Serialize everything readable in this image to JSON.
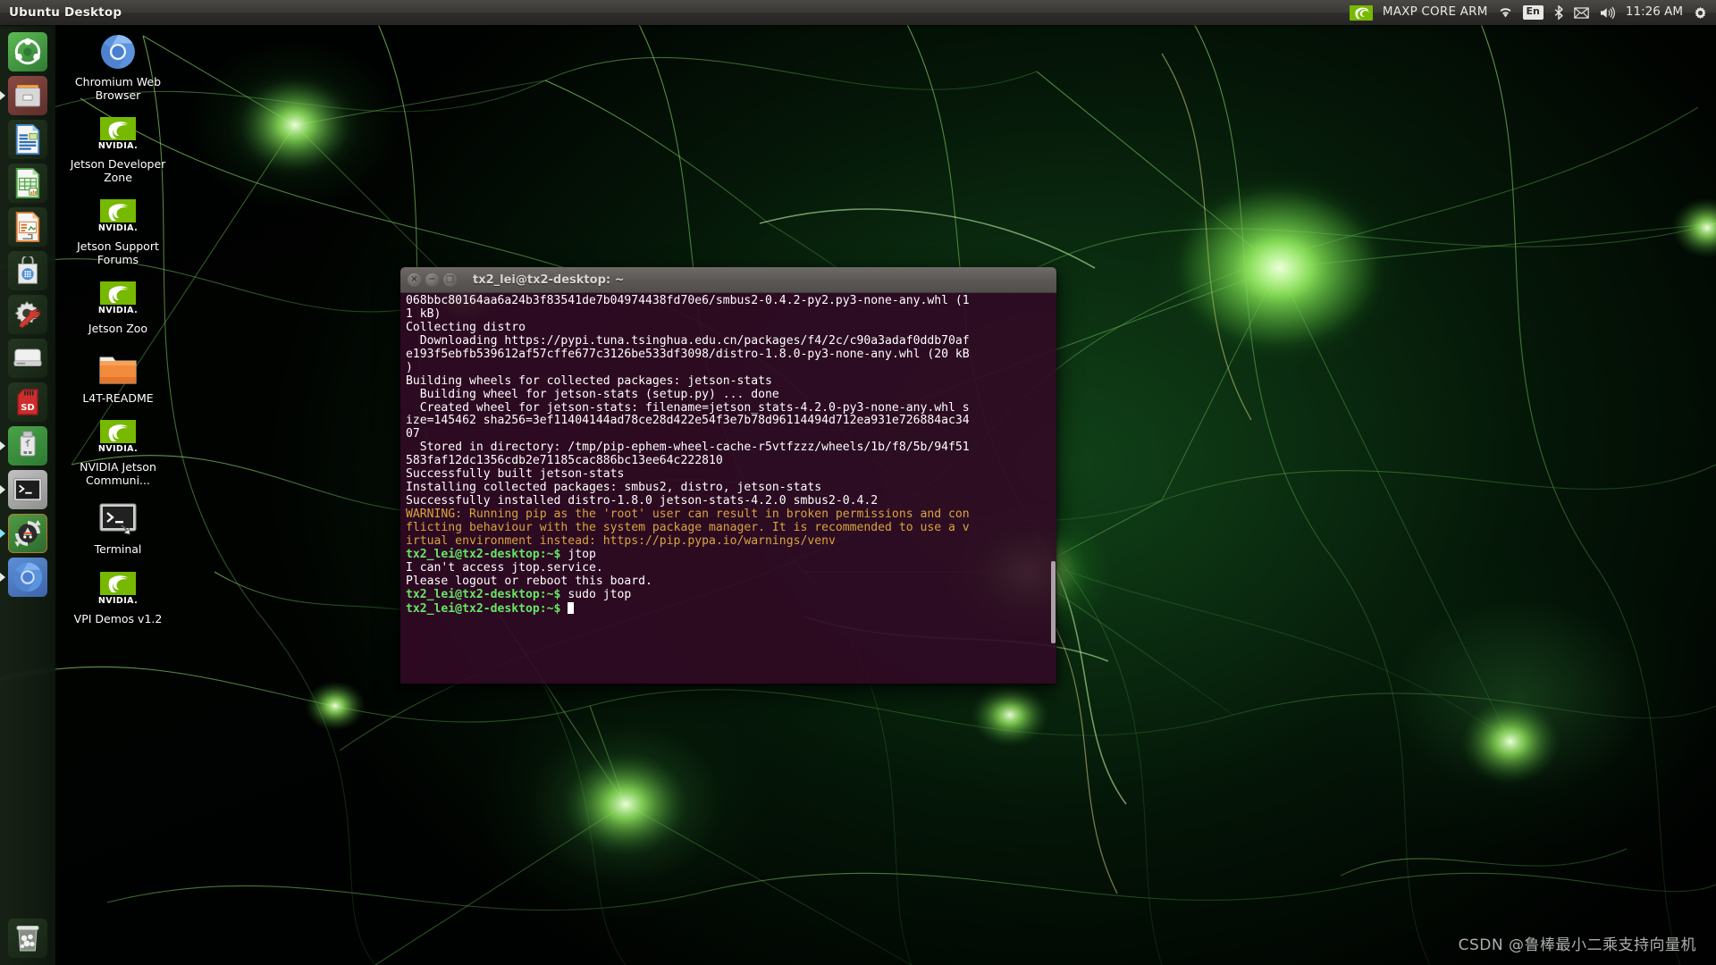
{
  "panel": {
    "title": "Ubuntu Desktop",
    "tray": {
      "nvidia_icon": "nvidia-eye-icon",
      "label": "MAXP CORE ARM",
      "wifi_icon": "wifi-icon",
      "language": "En",
      "bluetooth_icon": "bluetooth-icon",
      "mail_icon": "mail-icon",
      "volume_icon": "volume-icon",
      "clock": "11:26 AM",
      "gear_icon": "gear-icon"
    }
  },
  "launcher": {
    "items": [
      {
        "name": "dash-home",
        "icon": "ubuntu-logo-icon",
        "running": false,
        "accent": "#3f9142"
      },
      {
        "name": "files",
        "icon": "file-manager-icon",
        "running": true,
        "accent": "#7c3a36"
      },
      {
        "name": "libreoffice-writer",
        "icon": "writer-icon",
        "running": false,
        "accent": "#2a3a2a"
      },
      {
        "name": "libreoffice-calc",
        "icon": "calc-icon",
        "running": false,
        "accent": "#2a3a2a"
      },
      {
        "name": "libreoffice-impress",
        "icon": "impress-icon",
        "running": false,
        "accent": "#2a3a2a"
      },
      {
        "name": "ubuntu-software",
        "icon": "software-center-icon",
        "running": false,
        "accent": "#2a3a2a"
      },
      {
        "name": "system-settings",
        "icon": "gear-wrench-icon",
        "running": false,
        "accent": "#2a3a2a"
      },
      {
        "name": "disk-drive",
        "icon": "hard-drive-icon",
        "running": false,
        "accent": "#2a3a2a"
      },
      {
        "name": "sd-card",
        "icon": "sd-card-icon",
        "running": false,
        "accent": "#2a3a2a"
      },
      {
        "name": "usb-drive",
        "icon": "usb-stick-icon",
        "running": true,
        "accent": "#3f9142"
      },
      {
        "name": "terminal",
        "icon": "terminal-icon",
        "running": true,
        "accent": "#9a9a9a"
      },
      {
        "name": "software-updater",
        "icon": "software-updater-icon",
        "running": true,
        "accent": "#3f7a36"
      },
      {
        "name": "chromium",
        "icon": "chromium-icon",
        "running": true,
        "accent": "#4a7fd1"
      }
    ],
    "trash": {
      "name": "trash",
      "icon": "trash-icon"
    }
  },
  "desktop_icons": [
    {
      "label": "Chromium Web Browser",
      "icon": "chromium-icon"
    },
    {
      "label": "NVIDIA Jetson Developer Zone",
      "icon": "nvidia-icon",
      "brand": "NVIDIA",
      "text": "Jetson Developer Zone"
    },
    {
      "label": "NVIDIA Jetson Support Forums",
      "icon": "nvidia-icon",
      "brand": "NVIDIA",
      "text": "Jetson Support Forums"
    },
    {
      "label": "NVIDIA Jetson Zoo",
      "icon": "nvidia-icon",
      "brand": "NVIDIA",
      "text": "Jetson Zoo"
    },
    {
      "label": "L4T-README",
      "icon": "folder-icon",
      "text": "L4T-README"
    },
    {
      "label": "NVIDIA Jetson Communi...",
      "icon": "nvidia-icon",
      "brand": "NVIDIA",
      "text": "NVIDIA Jetson Communi..."
    },
    {
      "label": "Terminal",
      "icon": "terminal-icon",
      "text": "Terminal"
    },
    {
      "label": "NVIDIA VPI Demos v1.2",
      "icon": "nvidia-icon",
      "brand": "NVIDIA",
      "text": "VPI Demos v1.2"
    }
  ],
  "terminal": {
    "title": "tx2_lei@tx2-desktop: ~",
    "buttons": {
      "close": "×",
      "minimize": "−",
      "maximize": "□"
    },
    "prompt": "tx2_lei@tx2-desktop:~$",
    "lines": [
      {
        "type": "out",
        "text": "068bbc80164aa6a24b3f83541de7b04974438fd70e6/smbus2-0.4.2-py2.py3-none-any.whl (1"
      },
      {
        "type": "out",
        "text": "1 kB)"
      },
      {
        "type": "out",
        "text": "Collecting distro"
      },
      {
        "type": "out",
        "text": "  Downloading https://pypi.tuna.tsinghua.edu.cn/packages/f4/2c/c90a3adaf0ddb70af"
      },
      {
        "type": "out",
        "text": "e193f5ebfb539612af57cffe677c3126be533df3098/distro-1.8.0-py3-none-any.whl (20 kB"
      },
      {
        "type": "out",
        "text": ")"
      },
      {
        "type": "out",
        "text": "Building wheels for collected packages: jetson-stats"
      },
      {
        "type": "out",
        "text": "  Building wheel for jetson-stats (setup.py) ... done"
      },
      {
        "type": "out",
        "text": "  Created wheel for jetson-stats: filename=jetson_stats-4.2.0-py3-none-any.whl s"
      },
      {
        "type": "out",
        "text": "ize=145462 sha256=3ef11404144ad78ce28d422e54f3e7b78d96114494d712ea931e726884ac34"
      },
      {
        "type": "out",
        "text": "07"
      },
      {
        "type": "out",
        "text": "  Stored in directory: /tmp/pip-ephem-wheel-cache-r5vtfzzz/wheels/1b/f8/5b/94f51"
      },
      {
        "type": "out",
        "text": "583faf12dc1356cdb2e71185cac886bc13ee64c222810"
      },
      {
        "type": "out",
        "text": "Successfully built jetson-stats"
      },
      {
        "type": "out",
        "text": "Installing collected packages: smbus2, distro, jetson-stats"
      },
      {
        "type": "out",
        "text": "Successfully installed distro-1.8.0 jetson-stats-4.2.0 smbus2-0.4.2"
      },
      {
        "type": "warn",
        "text": "WARNING: Running pip as the 'root' user can result in broken permissions and con"
      },
      {
        "type": "warn",
        "text": "flicting behaviour with the system package manager. It is recommended to use a v"
      },
      {
        "type": "warn",
        "text": "irtual environment instead: https://pip.pypa.io/warnings/venv"
      },
      {
        "type": "cmd",
        "prompt": "tx2_lei@tx2-desktop:~$",
        "text": " jtop"
      },
      {
        "type": "out",
        "text": "I can't access jtop.service."
      },
      {
        "type": "out",
        "text": "Please logout or reboot this board."
      },
      {
        "type": "cmd",
        "prompt": "tx2_lei@tx2-desktop:~$",
        "text": " sudo jtop"
      },
      {
        "type": "cursor",
        "prompt": "tx2_lei@tx2-desktop:~$",
        "text": " "
      }
    ]
  },
  "watermark": "CSDN @鲁棒最小二乘支持向量机",
  "colors": {
    "nvidia_green": "#76b900",
    "terminal_bg": "#300a24",
    "terminal_warn": "#d9a441",
    "terminal_prompt": "#67e667",
    "panel_bg": "#3b3936"
  }
}
